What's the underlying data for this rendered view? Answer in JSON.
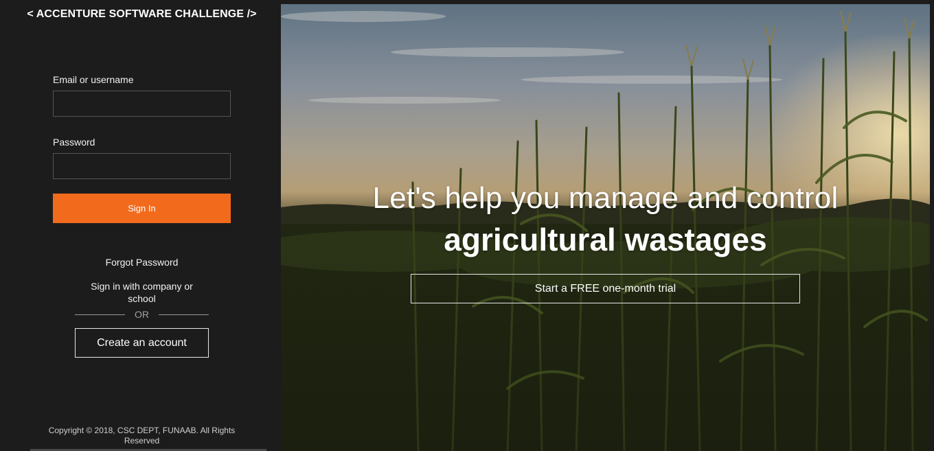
{
  "brand": {
    "title": "< ACCENTURE SOFTWARE CHALLENGE />"
  },
  "login": {
    "email_label": "Email or username",
    "email_value": "",
    "password_label": "Password",
    "password_value": "",
    "signin_label": "Sign In",
    "forgot_label": "Forgot Password",
    "company_signin_label": "Sign in with company or school",
    "or_label": "OR",
    "create_account_label": "Create an account"
  },
  "footer": {
    "copyright": "Copyright © 2018, CSC DEPT, FUNAAB. All Rights Reserved"
  },
  "hero": {
    "headline_line1": "Let's help you manage and control",
    "headline_line2": "agricultural wastages",
    "trial_label": "Start a FREE one-month trial"
  },
  "colors": {
    "accent": "#f26b1d",
    "sidebar_bg": "#1c1c1c",
    "text": "#ffffff"
  }
}
